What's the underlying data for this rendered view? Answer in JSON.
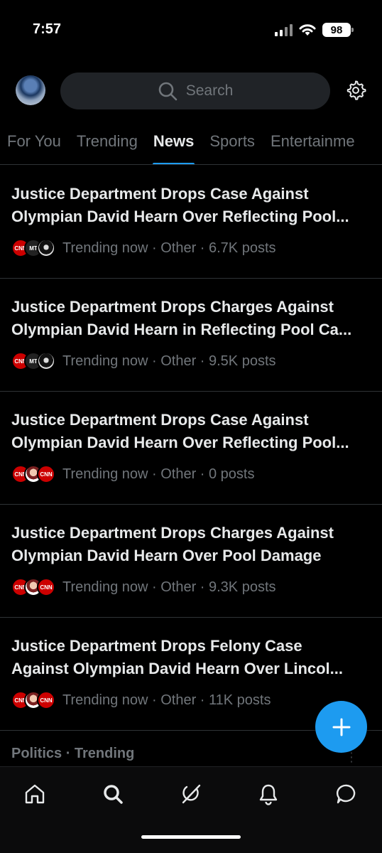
{
  "status_bar": {
    "time": "7:57",
    "battery": "98"
  },
  "header": {
    "search_placeholder": "Search"
  },
  "tabs": [
    {
      "label": "For You"
    },
    {
      "label": "Trending"
    },
    {
      "label": "News",
      "active": true
    },
    {
      "label": "Sports"
    },
    {
      "label": "Entertainme"
    }
  ],
  "feed": [
    {
      "line1": "Justice Department Drops Case Against",
      "line2": "Olympian David Hearn Over Reflecting Pool...",
      "meta": "Trending now · Other · 6.7K posts",
      "logos": [
        "cnn-logo",
        "mt-logo",
        "dark-logo"
      ]
    },
    {
      "line1": "Justice Department Drops Charges Against",
      "line2": "Olympian David Hearn in Reflecting Pool Ca...",
      "meta": "Trending now · Other · 9.5K posts",
      "logos": [
        "cnn-logo",
        "mt-logo",
        "dark-logo"
      ]
    },
    {
      "line1": "Justice Department Drops Case Against",
      "line2": "Olympian David Hearn Over Reflecting Pool...",
      "meta": "Trending now · Other · 0 posts",
      "logos": [
        "cnn-logo",
        "face-logo",
        "cnn-logo"
      ]
    },
    {
      "line1": "Justice Department Drops Charges Against",
      "line2": "Olympian David Hearn Over Pool Damage",
      "meta": "Trending now · Other · 9.3K posts",
      "logos": [
        "cnn-logo",
        "face-logo",
        "cnn-logo"
      ]
    },
    {
      "line1": "Justice Department Drops Felony Case",
      "line2": "Against Olympian David Hearn Over Lincol...",
      "meta": "Trending now · Other · 11K posts",
      "logos": [
        "cnn-logo",
        "face-logo",
        "cnn-logo"
      ]
    }
  ],
  "peek": {
    "label": "Politics · Trending"
  },
  "logo_text": {
    "cnn": "CNN",
    "mt": "MT"
  },
  "colors": {
    "accent": "#1d9bf0",
    "background": "#000000",
    "muted": "#71767b"
  }
}
